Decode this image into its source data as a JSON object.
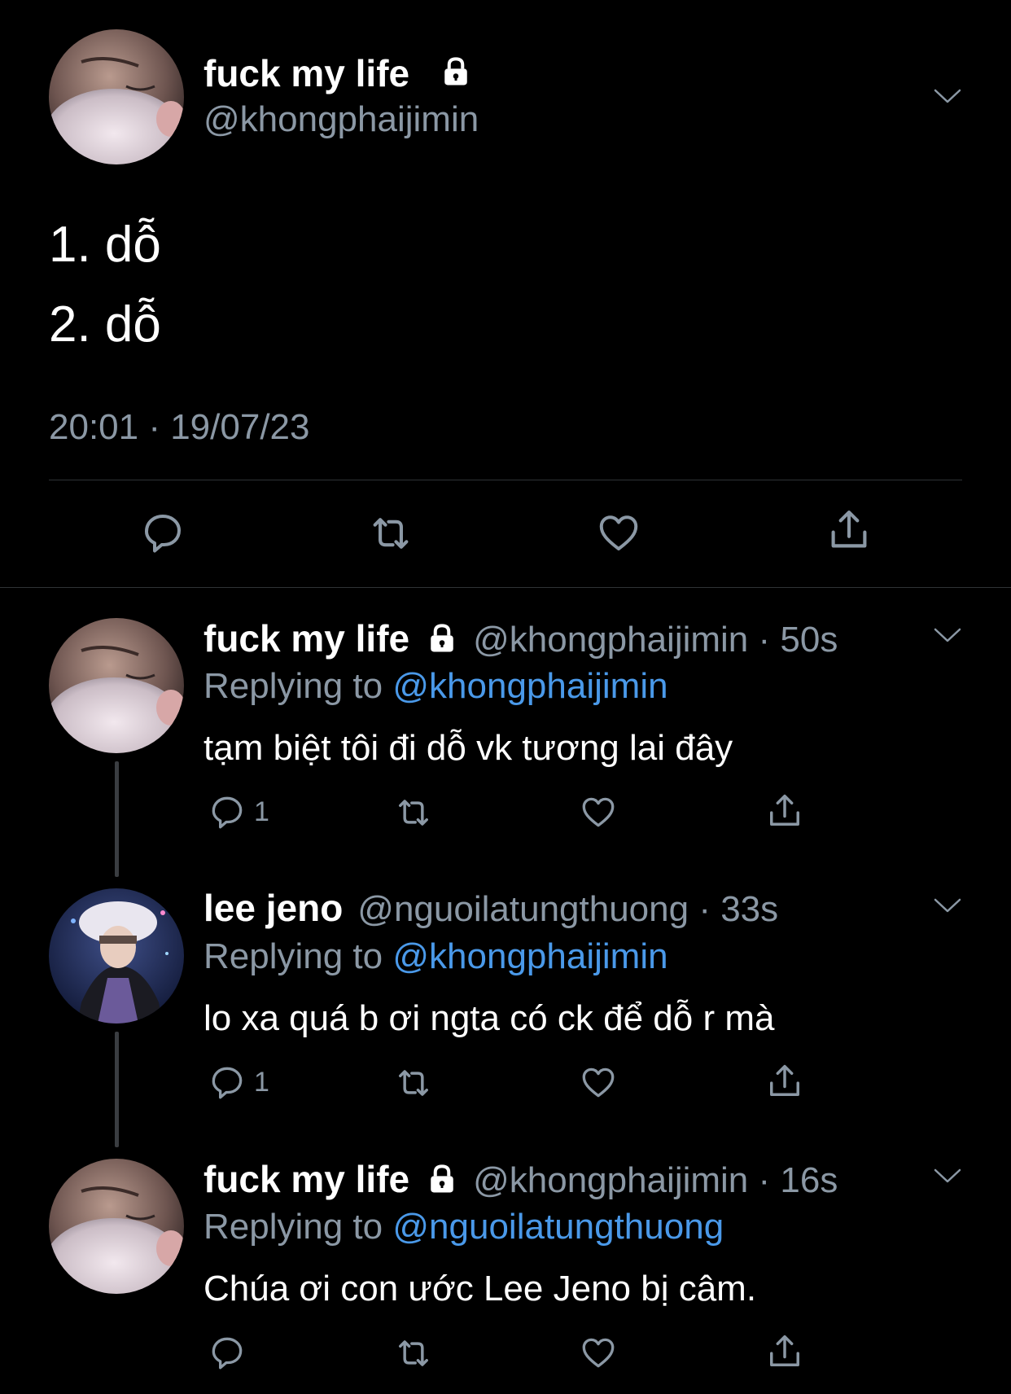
{
  "main_tweet": {
    "display_name": "fuck my life",
    "handle": "@khongphaijimin",
    "lines": [
      "1. dỗ",
      "2. dỗ"
    ],
    "timestamp": "20:01 · 19/07/23"
  },
  "replies": [
    {
      "display_name": "fuck my life",
      "handle": "@khongphaijimin",
      "time": "50s",
      "replying_prefix": "Replying to",
      "replying_to": "@khongphaijimin",
      "text": "tạm biệt tôi đi dỗ vk tương lai đây",
      "reply_count": "1"
    },
    {
      "display_name": "lee jeno",
      "handle": "@nguoilatungthuong",
      "time": "33s",
      "replying_prefix": "Replying to",
      "replying_to": "@khongphaijimin",
      "text": "lo xa quá b ơi ngta có ck để dỗ r mà",
      "reply_count": "1"
    },
    {
      "display_name": "fuck my life",
      "handle": "@khongphaijimin",
      "time": "16s",
      "replying_prefix": "Replying to",
      "replying_to": "@nguoilatungthuong",
      "text": "Chúa ơi con ước Lee Jeno bị câm.",
      "reply_count": ""
    }
  ],
  "icons": {
    "lock": "lock-icon",
    "chevron": "chevron-down-icon",
    "reply": "reply-icon",
    "retweet": "retweet-icon",
    "like": "heart-icon",
    "share": "share-icon"
  },
  "colors": {
    "background": "#000000",
    "text": "#ffffff",
    "muted": "#8b98a5",
    "link": "#4a99e9",
    "divider": "#2f3336"
  }
}
